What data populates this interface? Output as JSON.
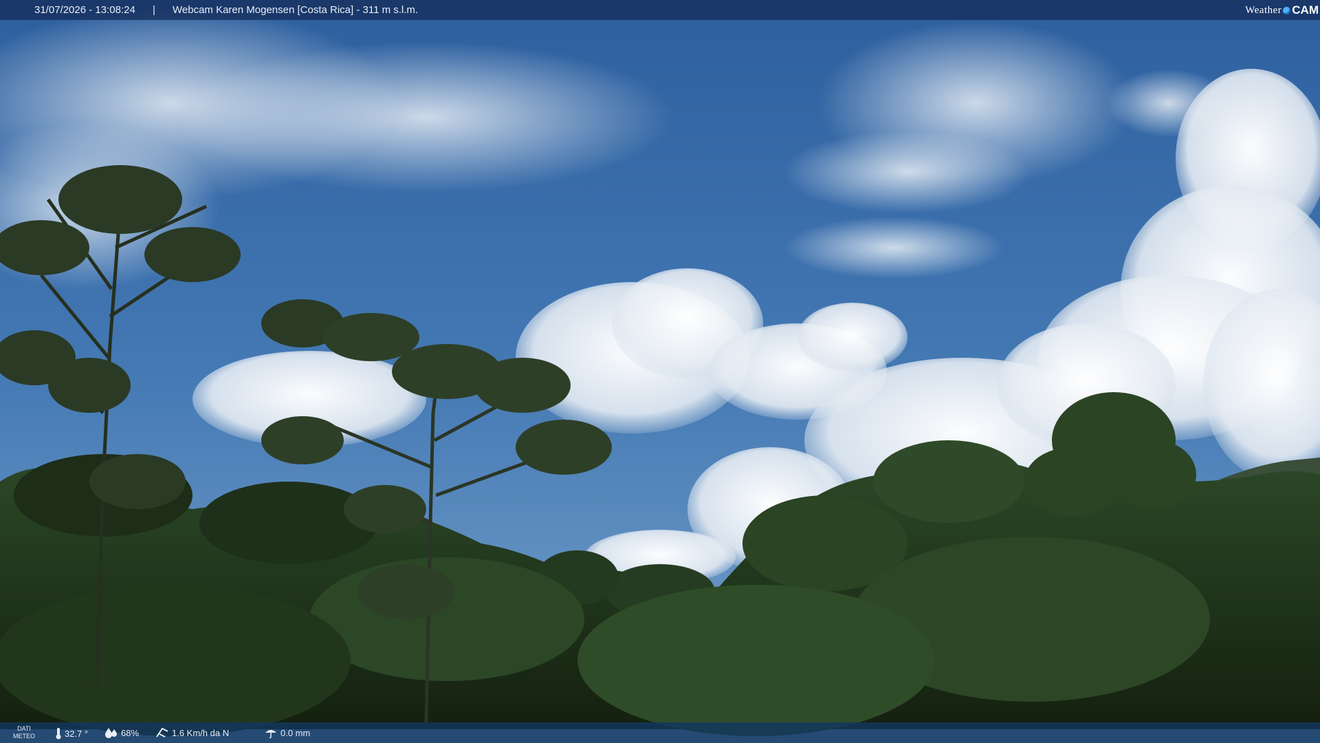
{
  "overlay": {
    "timestamp": "31/07/2026 - 13:08:24",
    "separator": "|",
    "title": "Webcam Karen Mogensen [Costa Rica]  - 311 m s.l.m.",
    "logo_word1": "Weather",
    "logo_word2": "CAM"
  },
  "weather": {
    "label_line1": "DATI",
    "label_line2": "METEO",
    "temperature": "32.7 °",
    "humidity": "68%",
    "wind": "1.6 Km/h da N",
    "rain": "0.0 mm"
  },
  "icons": {
    "temperature": "thermometer-icon",
    "humidity": "humidity-drop-icon",
    "wind": "wind-icon",
    "rain": "rain-icon"
  },
  "colors": {
    "sky_top": "#2f64a3",
    "sky_bottom": "#6f9cc8",
    "cloud": "#eef2f6",
    "forest_dark": "#1c2a1a",
    "forest_mid": "#3a5a30",
    "bar": "#14375f"
  }
}
